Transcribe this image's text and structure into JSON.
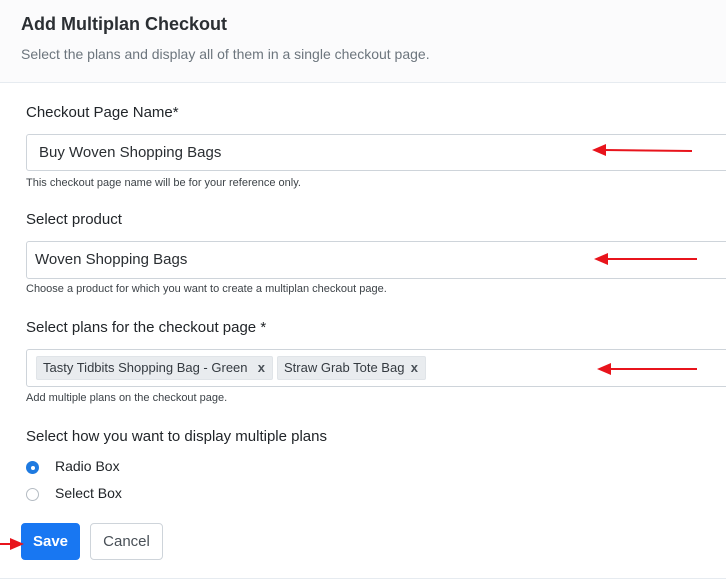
{
  "header": {
    "title": "Add Multiplan Checkout",
    "subtitle": "Select the plans and display all of them in a single checkout page."
  },
  "checkout_name": {
    "label": "Checkout Page Name*",
    "value": "Buy Woven Shopping Bags",
    "help": "This checkout page name will be for your reference only."
  },
  "product": {
    "label": "Select product",
    "selected": "Woven Shopping Bags",
    "help": "Choose a product for which you want to create a multiplan checkout page."
  },
  "plans": {
    "label": "Select plans for the checkout page *",
    "tags": [
      {
        "label": "Tasty Tidbits Shopping Bag - Green",
        "remove": "x"
      },
      {
        "label": "Straw Grab Tote Bag",
        "remove": "x"
      }
    ],
    "help": "Add multiple plans on the checkout page."
  },
  "display": {
    "label": "Select how you want to display multiple plans",
    "options": [
      {
        "label": "Radio Box",
        "selected": true
      },
      {
        "label": "Select Box",
        "selected": false
      }
    ]
  },
  "buttons": {
    "save": "Save",
    "cancel": "Cancel"
  },
  "colors": {
    "primary": "#1877f2",
    "annotation_arrow": "#e8141c"
  }
}
